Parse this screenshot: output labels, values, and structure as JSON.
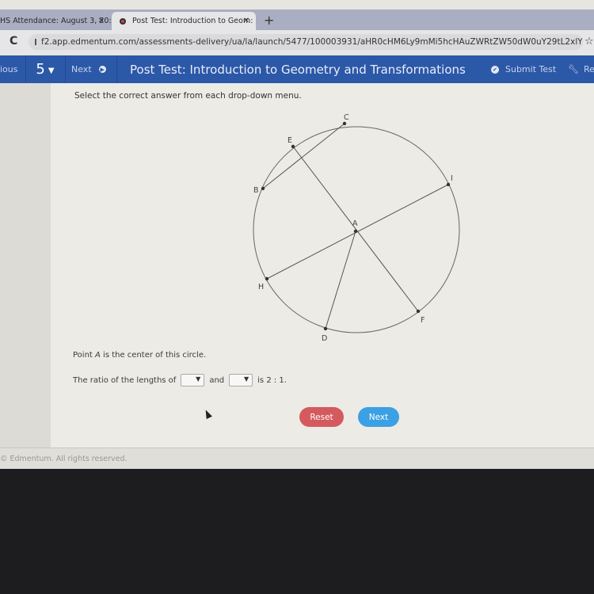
{
  "browser": {
    "tabs": [
      {
        "label": "HS Attendance: August 3, 20:",
        "active": false
      },
      {
        "label": "Post Test: Introduction to Geom:",
        "active": true
      }
    ],
    "new_tab_icon": "plus-icon",
    "url": "f2.app.edmentum.com/assessments-delivery/ua/la/launch/5477/100003931/aHR0cHM6Ly9mMi5hcHAuZWRtZW50dW0uY29tL2xlYXJu..."
  },
  "appbar": {
    "previous_label": "ious",
    "question_number": "5",
    "next_label": "Next",
    "title": "Post Test: Introduction to Geometry and Transformations",
    "submit_label": "Submit Test",
    "review_label": "Re"
  },
  "question": {
    "instructions": "Select the correct answer from each drop-down menu.",
    "figure": {
      "points": [
        "A",
        "B",
        "C",
        "D",
        "E",
        "F",
        "H",
        "I"
      ],
      "segments": [
        "BC",
        "EF",
        "HI",
        "AD"
      ],
      "center": "A"
    },
    "prompt_pre": "Point ",
    "prompt_var": "A",
    "prompt_post": " is the center of this circle.",
    "ratio_pre": "The ratio of the lengths of",
    "ratio_mid": "and",
    "ratio_post": "is 2 : 1.",
    "dropdown1_value": "",
    "dropdown2_value": ""
  },
  "buttons": {
    "reset": "Reset",
    "next": "Next"
  },
  "footer": {
    "copyright": "© Edmentum. All rights reserved."
  }
}
